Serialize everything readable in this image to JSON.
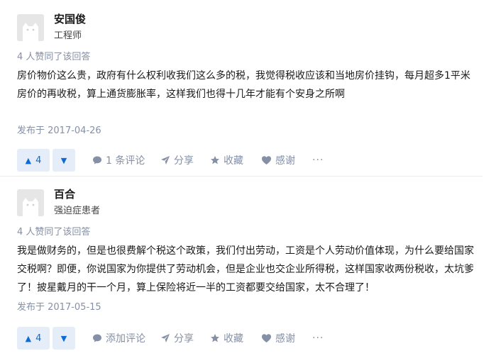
{
  "answers": [
    {
      "author": {
        "name": "安国俊",
        "bio": "工程师"
      },
      "votes_text": "4 人赞同了该回答",
      "content": "房价物价这么贵，政府有什么权利收我们这么多的税，我觉得税收应该和当地房价挂钩，每月超多1平米房价的再收税，算上通货膨胀率，这样我们也得十几年才能有个安身之所啊",
      "date": "发布于 2017-04-26",
      "actions": {
        "upvote_count": "4",
        "comment": "1 条评论",
        "share": "分享",
        "favorite": "收藏",
        "thanks": "感谢",
        "more": "···"
      }
    },
    {
      "author": {
        "name": "百合",
        "bio": "强迫症患者"
      },
      "votes_text": "4 人赞同了该回答",
      "content": "我是做财务的，但是也很费解个税这个政策，我们付出劳动，工资是个人劳动价值体现，为什么要给国家交税啊？即便，你说国家为你提供了劳动机会，但是企业也交企业所得税，这样国家收两份税收，太坑爹了！披星戴月的干一个月，算上保险将近一半的工资都要交给国家，太不合理了！",
      "date": "发布于 2017-05-15",
      "actions": {
        "upvote_count": "4",
        "comment": "添加评论",
        "share": "分享",
        "favorite": "收藏",
        "thanks": "感谢",
        "more": "···"
      }
    }
  ],
  "icons": {
    "upvote": "triangle-up-icon",
    "downvote": "triangle-down-icon",
    "comment": "comment-bubble-icon",
    "share": "paper-plane-icon",
    "favorite": "star-icon",
    "thanks": "heart-icon",
    "more": "ellipsis-icon"
  },
  "colors": {
    "accent": "#0f6ad4",
    "accent_bg": "#e5eef8",
    "meta": "#8590a6"
  }
}
